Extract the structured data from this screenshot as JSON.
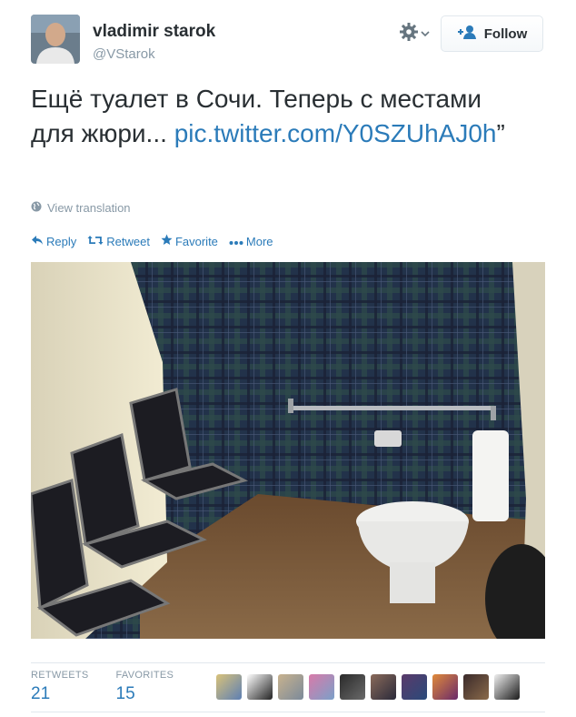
{
  "user": {
    "name": "vladimir starok",
    "handle": "@VStarok"
  },
  "header": {
    "follow_label": "Follow"
  },
  "tweet": {
    "text": "Ещё туалет в Сочи. Теперь с местами для жюри... ",
    "link": "pic.twitter.com/Y0SZUhAJ0h",
    "trailing_quote": "”",
    "translate_label": "View translation"
  },
  "actions": {
    "reply": "Reply",
    "retweet": "Retweet",
    "favorite": "Favorite",
    "more": "More"
  },
  "stats": {
    "retweets_label": "RETWEETS",
    "retweets_value": "21",
    "favorites_label": "FAVORITES",
    "favorites_value": "15"
  },
  "icons": [
    "gear-icon",
    "chevron-down-icon",
    "follow-person-icon",
    "globe-icon",
    "reply-icon",
    "retweet-icon",
    "star-icon",
    "more-dots-icon"
  ],
  "colors": {
    "link": "#2b7bb9",
    "muted": "#8899a6",
    "text": "#292f33"
  }
}
